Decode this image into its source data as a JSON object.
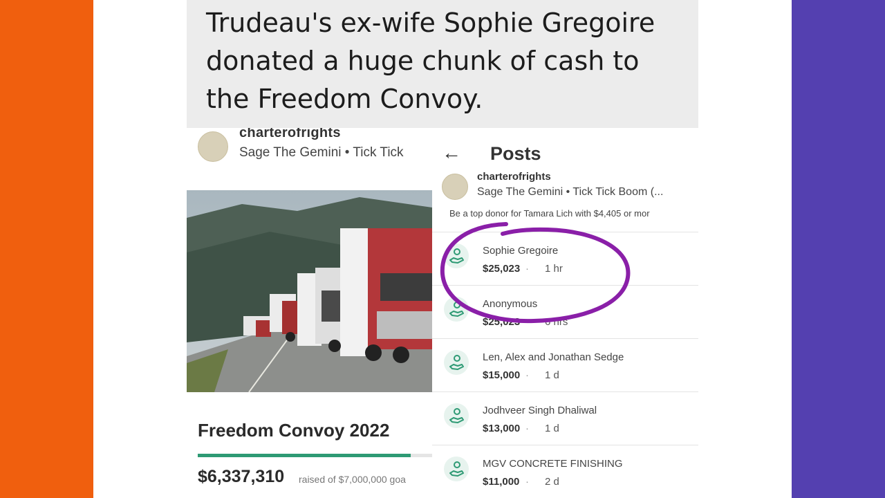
{
  "caption": {
    "line1": "Trudeau's ex-wife Sophie Gregoire",
    "line2": "donated a huge chunk of cash to",
    "line3": "the Freedom Convoy."
  },
  "left_panel": {
    "account": "charterofrights",
    "song": "Sage The Gemini • Tick Tick",
    "campaign_title": "Freedom Convoy 2022",
    "raised_amount": "$6,337,310",
    "goal_text": "raised of $7,000,000 goa",
    "progress_fraction": 0.905
  },
  "right_panel": {
    "header_title": "Posts",
    "account": "charterofrights",
    "song": "Sage The Gemini • Tick Tick Boom (...",
    "promo": "Be a top donor for Tamara Lich with $4,405 or mor",
    "donations": [
      {
        "name": "Sophie Gregoire",
        "amount": "$25,023",
        "time": "1 hr"
      },
      {
        "name": "Anonymous",
        "amount": "$25,023",
        "time": "6 hrs"
      },
      {
        "name": "Len, Alex and Jonathan Sedge",
        "amount": "$15,000",
        "time": "1 d"
      },
      {
        "name": "Jodhveer Singh Dhaliwal",
        "amount": "$13,000",
        "time": "1 d"
      },
      {
        "name": "MGV CONCRETE FINISHING",
        "amount": "$11,000",
        "time": "2 d"
      }
    ]
  },
  "colors": {
    "left_bar": "#f05f0e",
    "right_bar": "#5440b0",
    "progress": "#2e9a74",
    "annotation_circle": "#8a1fa8",
    "donor_icon": "#2e9a74"
  },
  "icons": [
    "back-arrow-icon",
    "donor-hand-icon"
  ]
}
